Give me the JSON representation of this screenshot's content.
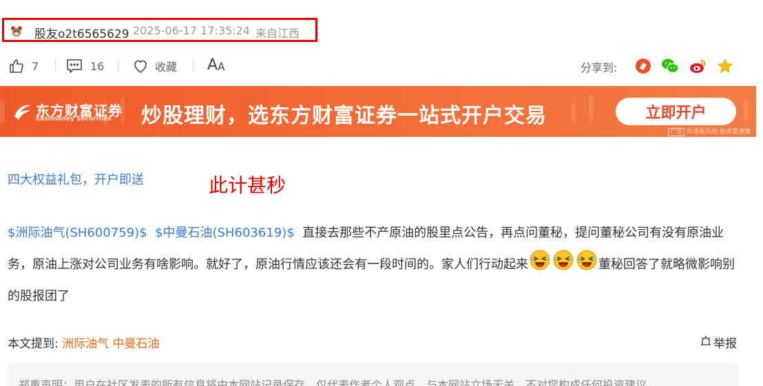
{
  "author": {
    "name": "股友o2t6565629",
    "date": "2025-06-17 17:35:24",
    "location": "来自江西"
  },
  "actions": {
    "like_count": "7",
    "comment_count": "16",
    "collect_label": "收藏",
    "font_label_big": "A",
    "font_label_small": "A",
    "share_label": "分享到:"
  },
  "share_icons": [
    "eastmoney-share-icon",
    "wechat-icon",
    "weibo-icon",
    "favorite-star-icon"
  ],
  "banner": {
    "brand": "东方财富证券",
    "brand_en": "Eastmoney Securities",
    "slogan": "炒股理财，选东方财富证券一站式开户交易",
    "cta": "立即开户",
    "ad_tag": "广告",
    "risk_note": "市场有风险 投资需谨慎"
  },
  "gift_link": "四大权益礼包，开户即送",
  "annotation": "此计甚秒",
  "post": {
    "stock1": "$洲际油气(SH600759)$",
    "stock2": "$中曼石油(SH603619)$",
    "text1": "直接去那些不产原油的股里点公告，再点问董秘，提问董秘公司有没有原油业务，原油上涨对公司业务有啥影响。就好了，原油行情应该还会有一段时间的。家人们行动起来",
    "text2": "董秘回答了就略微影响别的股报团了"
  },
  "mentioned": {
    "label": "本文提到:",
    "link1": "洲际油气",
    "link2": "中曼石油"
  },
  "report_label": "举报",
  "disclaimer": "郑重声明：用户在社区发表的所有信息将由本网站记录保存，仅代表作者个人观点，与本网站立场无关，不对您构成任何投资建议",
  "colors": {
    "accent_blue": "#3a7bd5",
    "orange_link": "#e96a1b",
    "banner_orange": "#f26a36",
    "highlight_red": "#e30000"
  }
}
